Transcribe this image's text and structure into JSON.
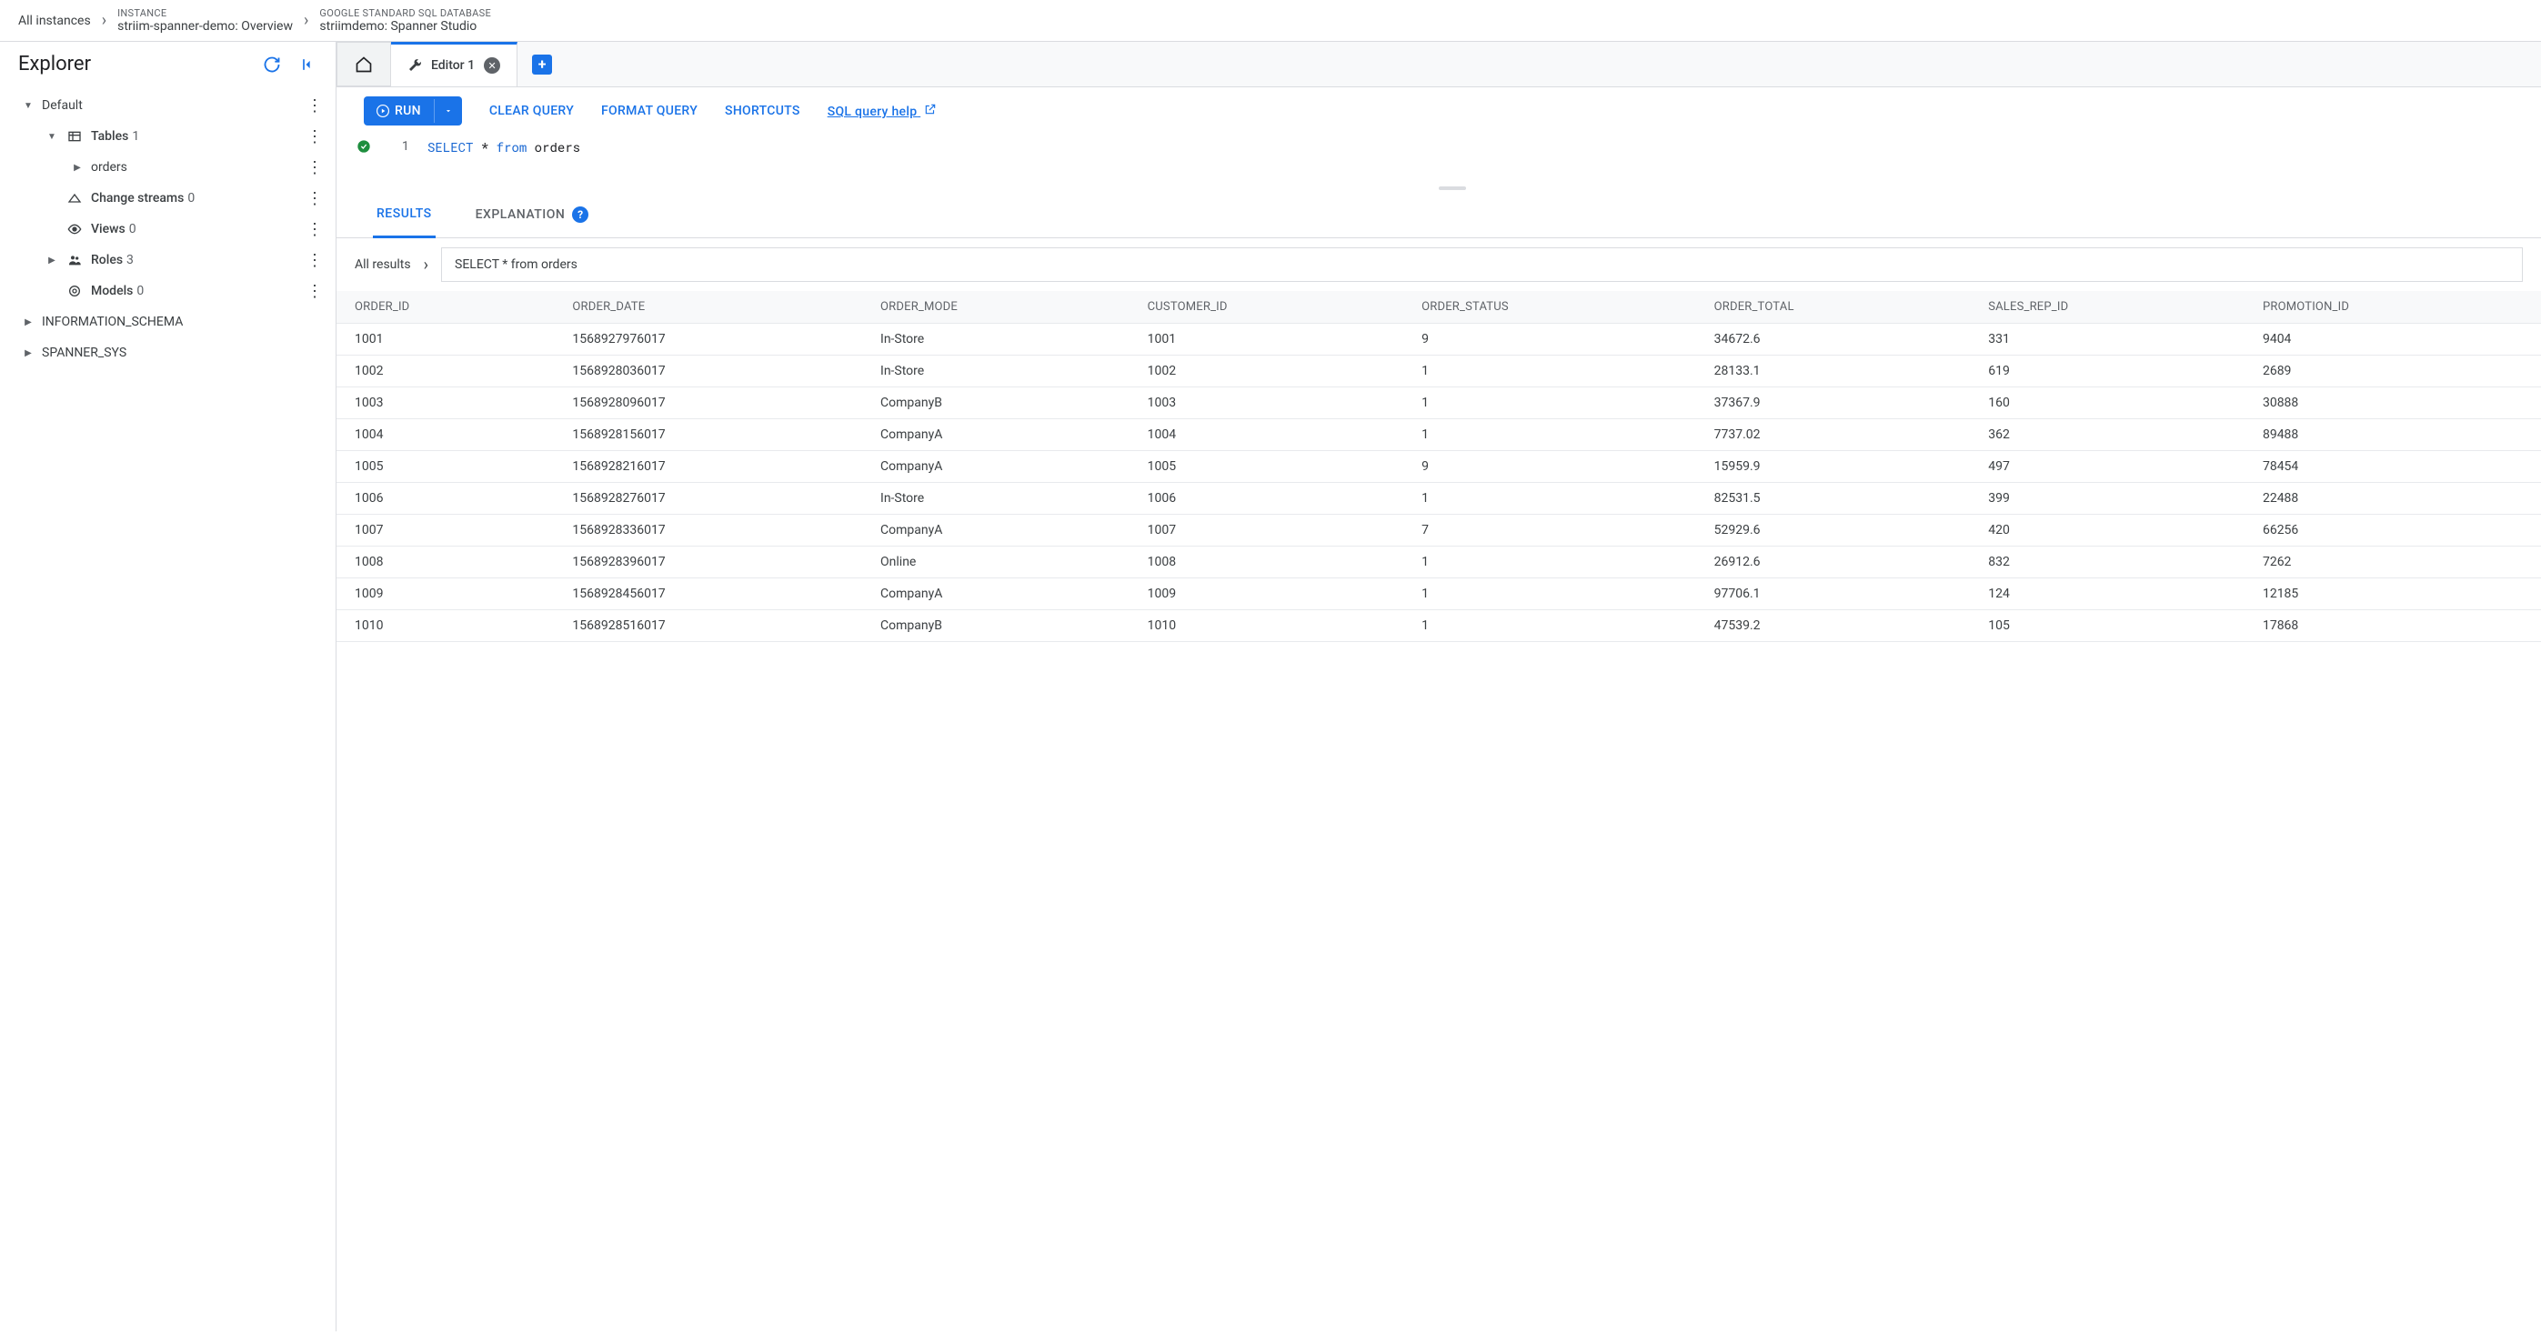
{
  "breadcrumb": {
    "root": "All instances",
    "instance_label": "INSTANCE",
    "instance_value": "striim-spanner-demo: Overview",
    "db_label": "GOOGLE STANDARD SQL DATABASE",
    "db_value": "striimdemo: Spanner Studio"
  },
  "explorer": {
    "title": "Explorer",
    "nodes": {
      "default": "Default",
      "tables": "Tables",
      "tables_count": "1",
      "orders": "orders",
      "change_streams": "Change streams",
      "change_streams_count": "0",
      "views": "Views",
      "views_count": "0",
      "roles": "Roles",
      "roles_count": "3",
      "models": "Models",
      "models_count": "0",
      "info_schema": "INFORMATION_SCHEMA",
      "spanner_sys": "SPANNER_SYS"
    }
  },
  "tabs": {
    "editor": "Editor 1"
  },
  "toolbar": {
    "run": "RUN",
    "clear": "CLEAR QUERY",
    "format": "FORMAT QUERY",
    "shortcuts": "SHORTCUTS",
    "help": "SQL query help"
  },
  "editor": {
    "line_no": "1",
    "kw_select": "SELECT",
    "star": "*",
    "kw_from": "from",
    "table": "orders"
  },
  "results": {
    "tab_results": "RESULTS",
    "tab_explanation": "EXPLANATION",
    "all_results": "All results",
    "query_text": "SELECT * from orders",
    "columns": [
      "ORDER_ID",
      "ORDER_DATE",
      "ORDER_MODE",
      "CUSTOMER_ID",
      "ORDER_STATUS",
      "ORDER_TOTAL",
      "SALES_REP_ID",
      "PROMOTION_ID"
    ],
    "rows": [
      [
        "1001",
        "1568927976017",
        "In-Store",
        "1001",
        "9",
        "34672.6",
        "331",
        "9404"
      ],
      [
        "1002",
        "1568928036017",
        "In-Store",
        "1002",
        "1",
        "28133.1",
        "619",
        "2689"
      ],
      [
        "1003",
        "1568928096017",
        "CompanyB",
        "1003",
        "1",
        "37367.9",
        "160",
        "30888"
      ],
      [
        "1004",
        "1568928156017",
        "CompanyA",
        "1004",
        "1",
        "7737.02",
        "362",
        "89488"
      ],
      [
        "1005",
        "1568928216017",
        "CompanyA",
        "1005",
        "9",
        "15959.9",
        "497",
        "78454"
      ],
      [
        "1006",
        "1568928276017",
        "In-Store",
        "1006",
        "1",
        "82531.5",
        "399",
        "22488"
      ],
      [
        "1007",
        "1568928336017",
        "CompanyA",
        "1007",
        "7",
        "52929.6",
        "420",
        "66256"
      ],
      [
        "1008",
        "1568928396017",
        "Online",
        "1008",
        "1",
        "26912.6",
        "832",
        "7262"
      ],
      [
        "1009",
        "1568928456017",
        "CompanyA",
        "1009",
        "1",
        "97706.1",
        "124",
        "12185"
      ],
      [
        "1010",
        "1568928516017",
        "CompanyB",
        "1010",
        "1",
        "47539.2",
        "105",
        "17868"
      ]
    ]
  }
}
